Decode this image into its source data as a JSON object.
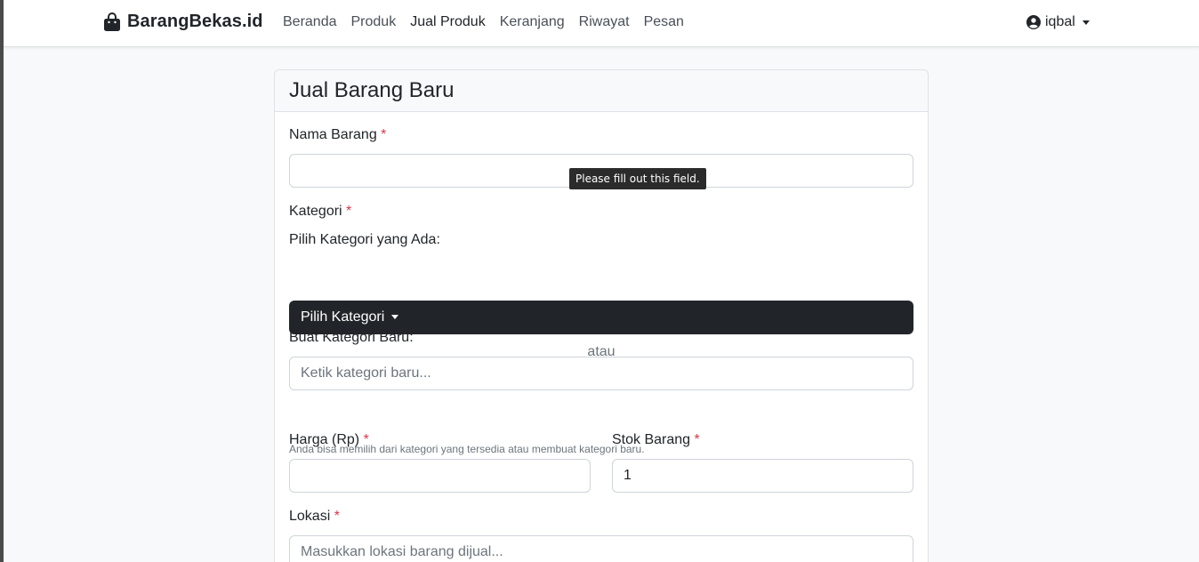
{
  "nav": {
    "brand": "BarangBekas.id",
    "links": [
      "Beranda",
      "Produk",
      "Jual Produk",
      "Keranjang",
      "Riwayat",
      "Pesan"
    ],
    "active_index": 2,
    "user": "iqbal"
  },
  "form": {
    "title": "Jual Barang Baru",
    "required_mark": "*",
    "nama_label": "Nama Barang",
    "nama_value": "",
    "validation_tooltip": "Please fill out this field.",
    "kategori_label": "Kategori",
    "pilih_label": "Pilih Kategori yang Ada:",
    "dropdown_label": "Pilih Kategori",
    "or_text": "atau",
    "buat_label": "Buat Kategori Baru:",
    "kategori_placeholder": "Ketik kategori baru...",
    "help_text": "Anda bisa memilih dari kategori yang tersedia atau membuat kategori baru.",
    "harga_label": "Harga (Rp)",
    "harga_value": "",
    "stok_label": "Stok Barang",
    "stok_value": "1",
    "lokasi_label": "Lokasi",
    "lokasi_placeholder": "Masukkan lokasi barang dijual..."
  },
  "colors": {
    "required": "#dc3545",
    "dropdown_bg": "#212529",
    "page_bg": "#f8f9fa"
  },
  "icons": {
    "brand": "shopping-bag-icon",
    "user": "user-circle-icon"
  }
}
